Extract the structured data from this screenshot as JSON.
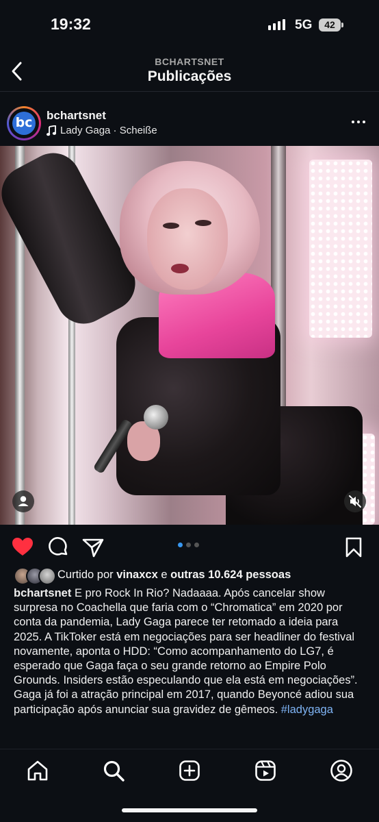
{
  "status": {
    "time": "19:32",
    "network": "5G",
    "battery": "42"
  },
  "header": {
    "account": "BCHARTSNET",
    "title": "Publicações"
  },
  "post": {
    "avatar_text": "bc",
    "username": "bchartsnet",
    "audio": "Lady Gaga · Scheiße",
    "carousel": {
      "count": 3,
      "active": 1
    },
    "likes": {
      "prefix": "Curtido por",
      "user": "vinaxcx",
      "middle": "e",
      "others": "outras 10.624 pessoas"
    },
    "caption": {
      "username": "bchartsnet",
      "text": "E pro Rock In Rio? Nadaaaa. Após cancelar show surpresa no Coachella que faria com o “Chromatica” em 2020 por conta da pandemia, Lady Gaga parece ter retomado a ideia para 2025. A TikToker está em negociações para ser headliner do festival novamente, aponta o HDD: “Como acompanhamento do LG7, é esperado que Gaga faça o seu grande retorno ao Empire Polo Grounds. Insiders estão especulando que ela está em negociações”. Gaga já foi a atração principal em 2017, quando Beyoncé adiou sua participação após anunciar sua gravidez de gêmeos.",
      "hashtag": "#ladygaga"
    }
  },
  "icons": {
    "back": "chevron-left-icon",
    "more": "more-horizontal-icon",
    "like": "heart-icon",
    "comment": "comment-icon",
    "share": "send-icon",
    "save": "bookmark-icon",
    "tag": "user-tag-icon",
    "mute": "speaker-muted-icon",
    "nav": [
      "home-icon",
      "search-icon",
      "create-icon",
      "reels-icon",
      "profile-icon"
    ]
  },
  "colors": {
    "like": "#ff3040",
    "carousel_active": "#3897f0",
    "hashtag": "#7fb4f5",
    "background": "#0c0f14"
  }
}
